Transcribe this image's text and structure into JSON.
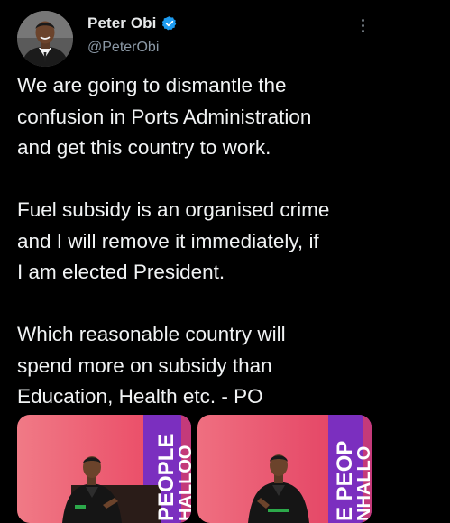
{
  "tweet": {
    "author": {
      "display_name": "Peter Obi",
      "handle": "@PeterObi",
      "verified": true,
      "avatar": "profile-photo"
    },
    "more_icon": "more-vertical-icon",
    "paragraphs": [
      "We are going to dismantle the\nconfusion in Ports Administration\nand get this country to work.",
      "Fuel subsidy is an organised crime\nand I will remove it immediately, if\nI am elected President.",
      "Which reasonable country will\nspend more on subsidy than\nEducation, Health etc. - PO"
    ],
    "media": [
      {
        "banner_text_1": "PEOPLE",
        "banner_text_2": "HALLOO"
      },
      {
        "banner_text_1": "E PEOP",
        "banner_text_2": "NHALLO"
      }
    ]
  },
  "colors": {
    "background": "#000000",
    "text": "#e7e9ea",
    "secondary_text": "#8b98a5",
    "verified_blue": "#1d9bf0",
    "stage_pink": "#e8466c",
    "banner_purple": "#7b2fbf"
  }
}
